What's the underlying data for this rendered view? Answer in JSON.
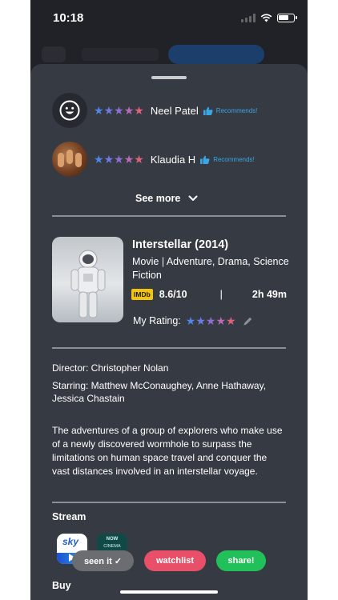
{
  "status": {
    "time": "10:18"
  },
  "reviews": [
    {
      "name": "Neel Patel",
      "recommend": "Recommends!",
      "avatar": "smiley-avatar-icon"
    },
    {
      "name": "Klaudia H",
      "recommend": "Recommends!",
      "avatar": "photo-avatar"
    }
  ],
  "star_colors": [
    "#4f86e8",
    "#6f7ae6",
    "#8f6fd6",
    "#b96bb8",
    "#e0627a"
  ],
  "see_more": "See more",
  "movie": {
    "title": "Interstellar (2014)",
    "genre": "Movie | Adventure, Drama, Science Fiction",
    "imdb_badge": "IMDb",
    "imdb_score": "8.6/10",
    "separator": "|",
    "runtime": "2h 49m",
    "my_rating_label": "My Rating:"
  },
  "credits": {
    "director": "Director: Christopher Nolan",
    "starring": "Starring: Matthew McConaughey, Anne Hathaway, Jessica Chastain"
  },
  "synopsis": "The adventures of a group of explorers who make use of a newly discovered wormhole to surpass the limitations on human space travel and conquer the vast distances involved in an interstellar voyage.",
  "sections": {
    "stream": "Stream",
    "buy": "Buy"
  },
  "providers": {
    "sky": {
      "label": "sky"
    },
    "now": {
      "top": "NOW",
      "bottom": "CINEMA"
    }
  },
  "actions": {
    "seen": "seen it ✓",
    "watchlist": "watchlist",
    "share": "share!"
  }
}
